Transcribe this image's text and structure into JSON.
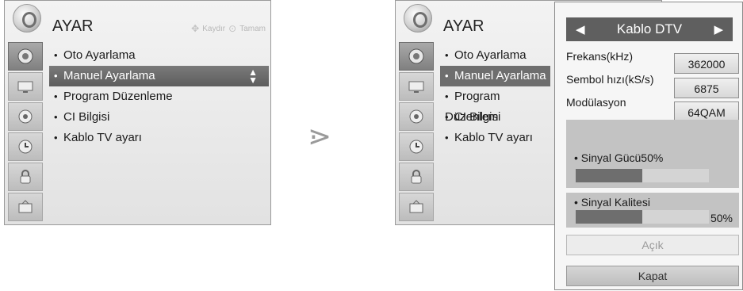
{
  "screen_left": {
    "title": "AYAR",
    "hints": {
      "scroll_label": "Kaydır",
      "ok_label": "Tamam"
    },
    "sidebar": [
      {
        "icon": "tv-setup-icon",
        "active": true
      },
      {
        "icon": "picture-icon",
        "active": false
      },
      {
        "icon": "audio-icon",
        "active": false
      },
      {
        "icon": "time-icon",
        "active": false
      },
      {
        "icon": "lock-icon",
        "active": false
      },
      {
        "icon": "option-icon",
        "active": false
      }
    ],
    "menu": [
      {
        "label": "Oto Ayarlama"
      },
      {
        "label": "Manuel Ayarlama",
        "selected": true
      },
      {
        "label": "Program Düzenleme"
      },
      {
        "label": "CI Bilgisi"
      },
      {
        "label": "Kablo TV ayarı"
      }
    ]
  },
  "screen_right": {
    "title": "AYAR",
    "menu": [
      {
        "label": "Oto Ayarlama"
      },
      {
        "label": "Manuel Ayarlama",
        "selected": true
      },
      {
        "label": "Program Düzenlem"
      },
      {
        "label": "CI Bilgisi"
      },
      {
        "label": "Kablo TV ayarı"
      }
    ]
  },
  "popup": {
    "channel_type": "Kablo DTV",
    "fields": [
      {
        "label": "Frekans(kHz)",
        "value": "362000"
      },
      {
        "label": "Sembol hızı(kS/s)",
        "value": "6875"
      },
      {
        "label": "Modülasyon",
        "value": "64QAM"
      }
    ],
    "signal_strength": {
      "label": "Sinyal Gücü50%",
      "level": 0.5
    },
    "signal_quality": {
      "label": "Sinyal Kalitesi",
      "percent": "50%",
      "level": 0.5
    },
    "on_button": "Açık",
    "close_button": "Kapat"
  },
  "separator_glyph": "⋗"
}
